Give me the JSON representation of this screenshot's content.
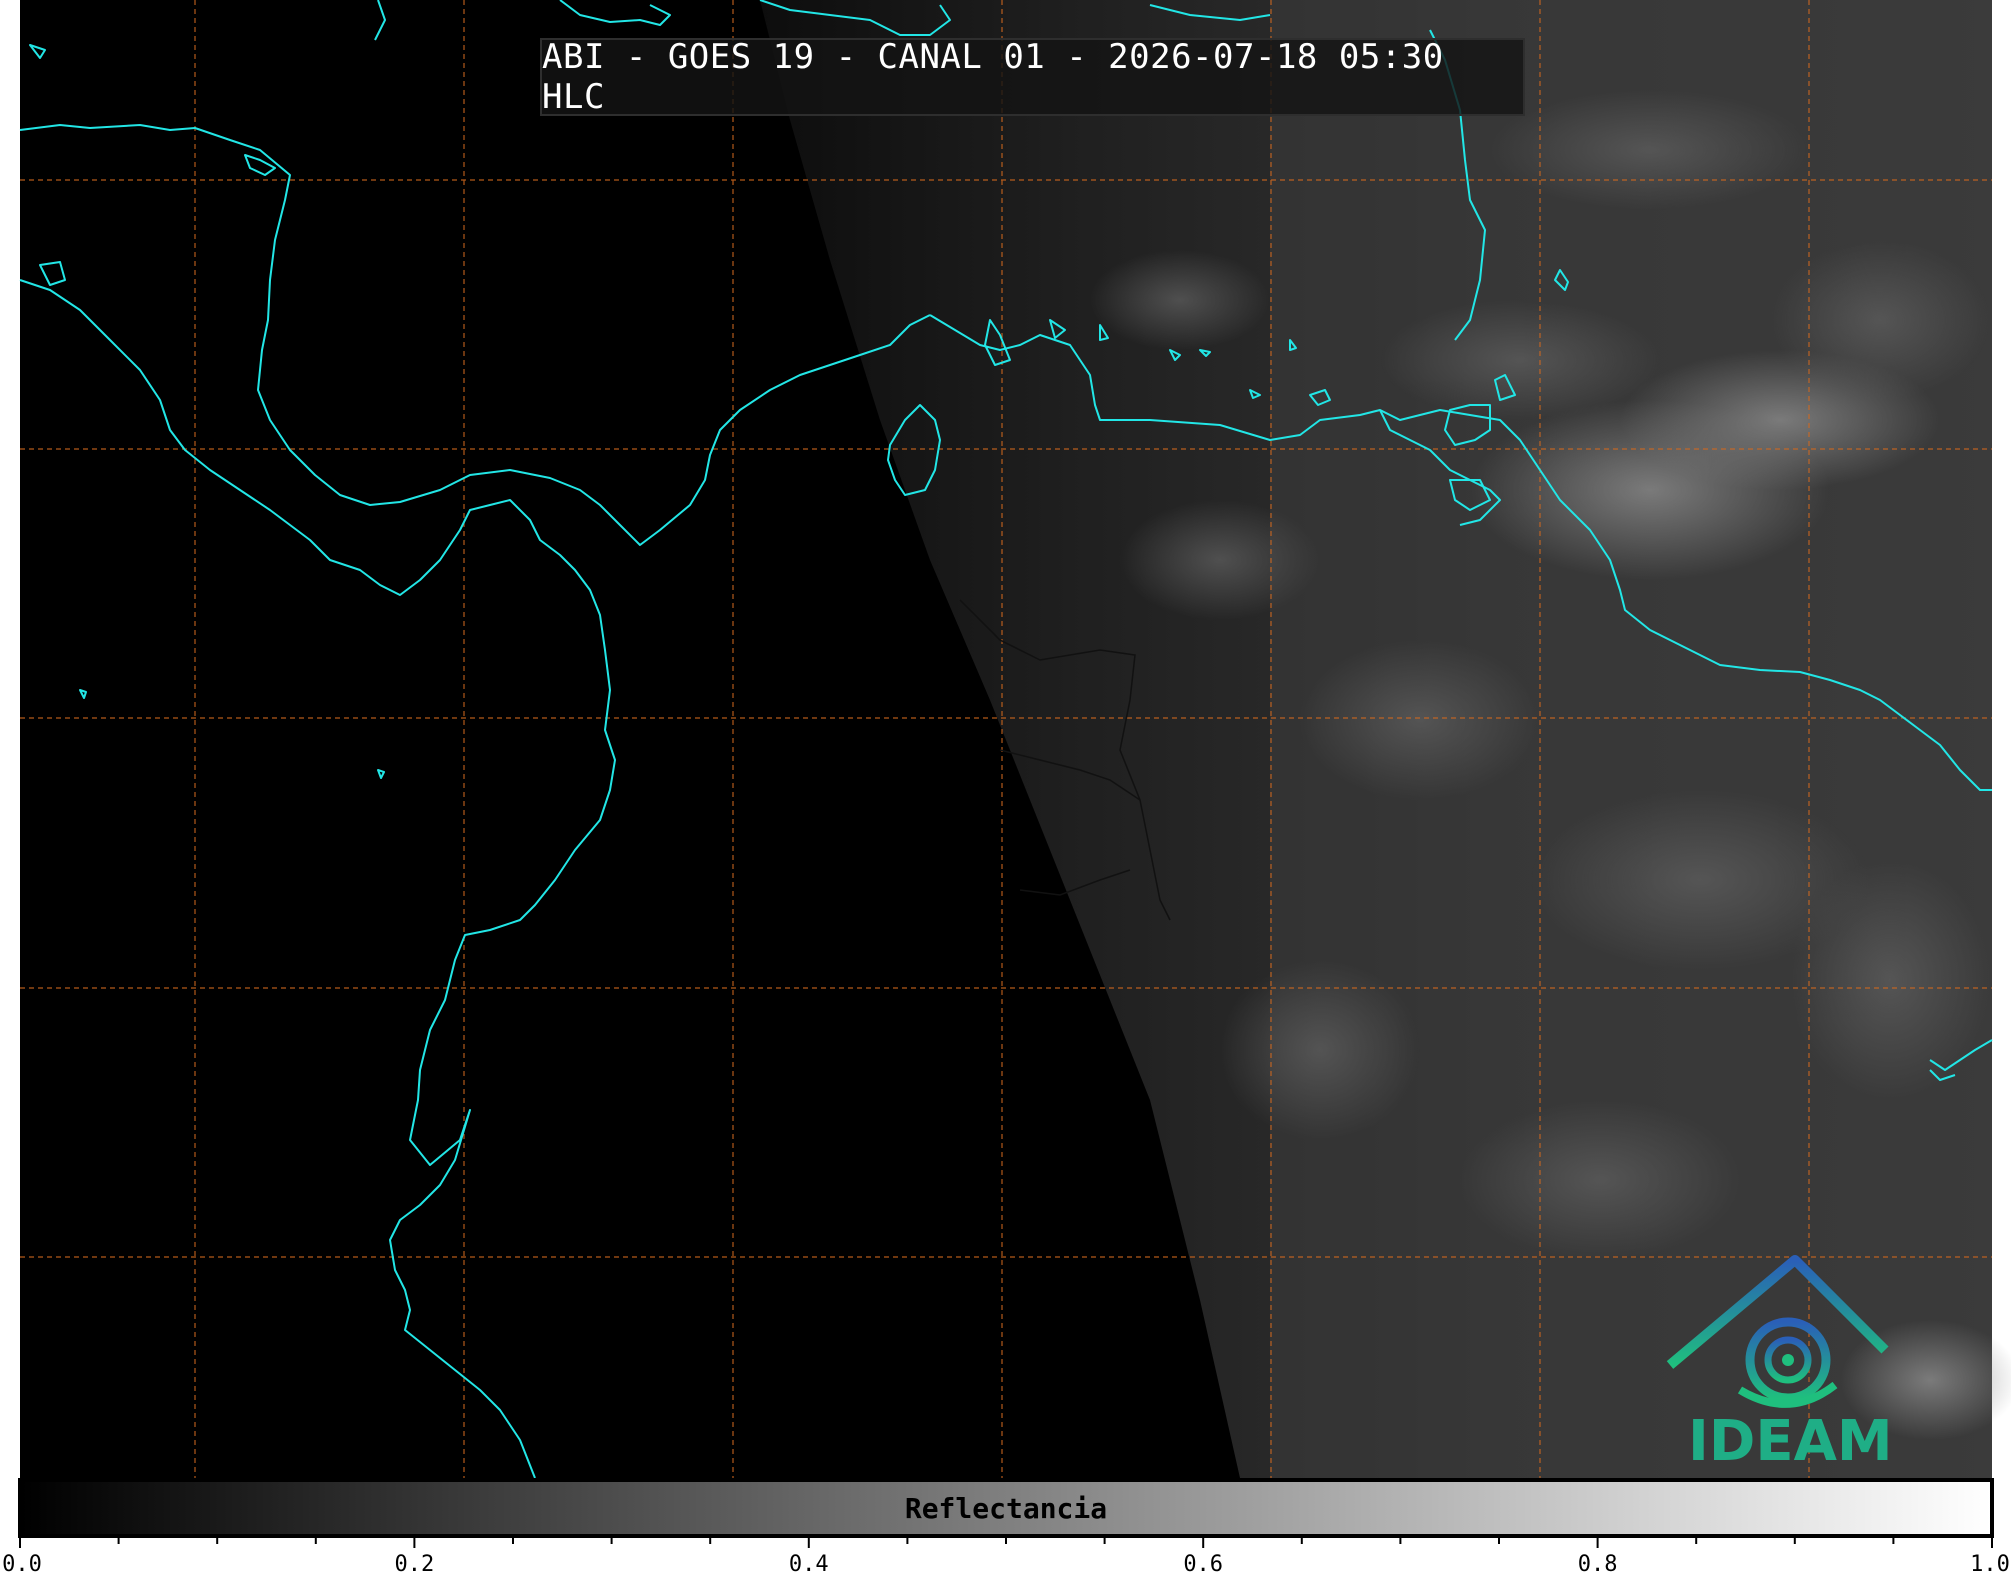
{
  "title": "ABI - GOES 19 - CANAL 01 - 2026-07-18 05:30 HLC",
  "logo": {
    "text": "IDEAM",
    "color": "#1fae86"
  },
  "colorbar": {
    "label": "Reflectancia",
    "range": [
      0.0,
      1.0
    ],
    "tick_labels": [
      "0.0",
      "0.2",
      "0.4",
      "0.6",
      "0.8",
      "1.0"
    ],
    "tick_values": [
      0.0,
      0.2,
      0.4,
      0.6,
      0.8,
      1.0
    ],
    "colormap": "grayscale"
  },
  "colors": {
    "coastline": "#22e6e6",
    "grid": "#d2691e",
    "borders": "#111111",
    "background": "#000000"
  },
  "map": {
    "grid_lines": "dashed",
    "day_night_terminator": "left half night (black), right half daylight (gray clouds)"
  }
}
